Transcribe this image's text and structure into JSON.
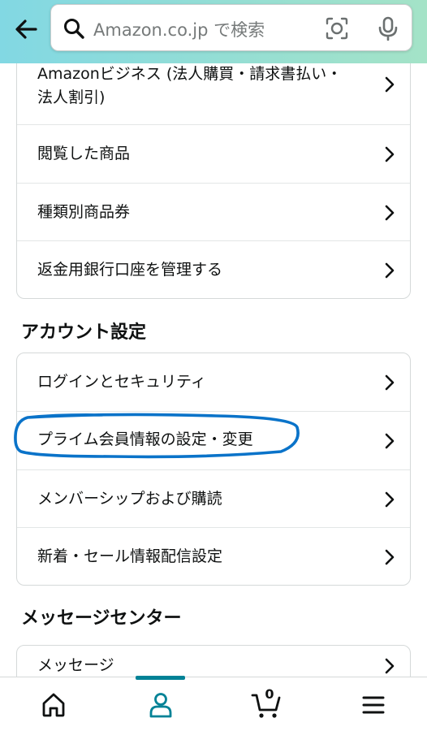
{
  "header": {
    "search_placeholder": "Amazon.co.jp で検索"
  },
  "account_services": {
    "items": [
      {
        "label": "Amazonビジネス (法人購買・請求書払い・法人割引)"
      },
      {
        "label": "閲覧した商品"
      },
      {
        "label": "種類別商品券"
      },
      {
        "label": "返金用銀行口座を管理する"
      }
    ]
  },
  "account_settings": {
    "title": "アカウント設定",
    "items": [
      {
        "label": "ログインとセキュリティ"
      },
      {
        "label": "プライム会員情報の設定・変更"
      },
      {
        "label": "メンバーシップおよび購読"
      },
      {
        "label": "新着・セール情報配信設定"
      }
    ]
  },
  "message_center": {
    "title": "メッセージセンター",
    "items": [
      {
        "label": "メッセージ"
      }
    ]
  },
  "bottom_nav": {
    "cart_count": "0",
    "active_tab": "account"
  },
  "colors": {
    "header_gradient_start": "#82d8e3",
    "header_gradient_end": "#a4e3c7",
    "nav_active": "#008296",
    "highlight_ink": "#0a73c9"
  }
}
